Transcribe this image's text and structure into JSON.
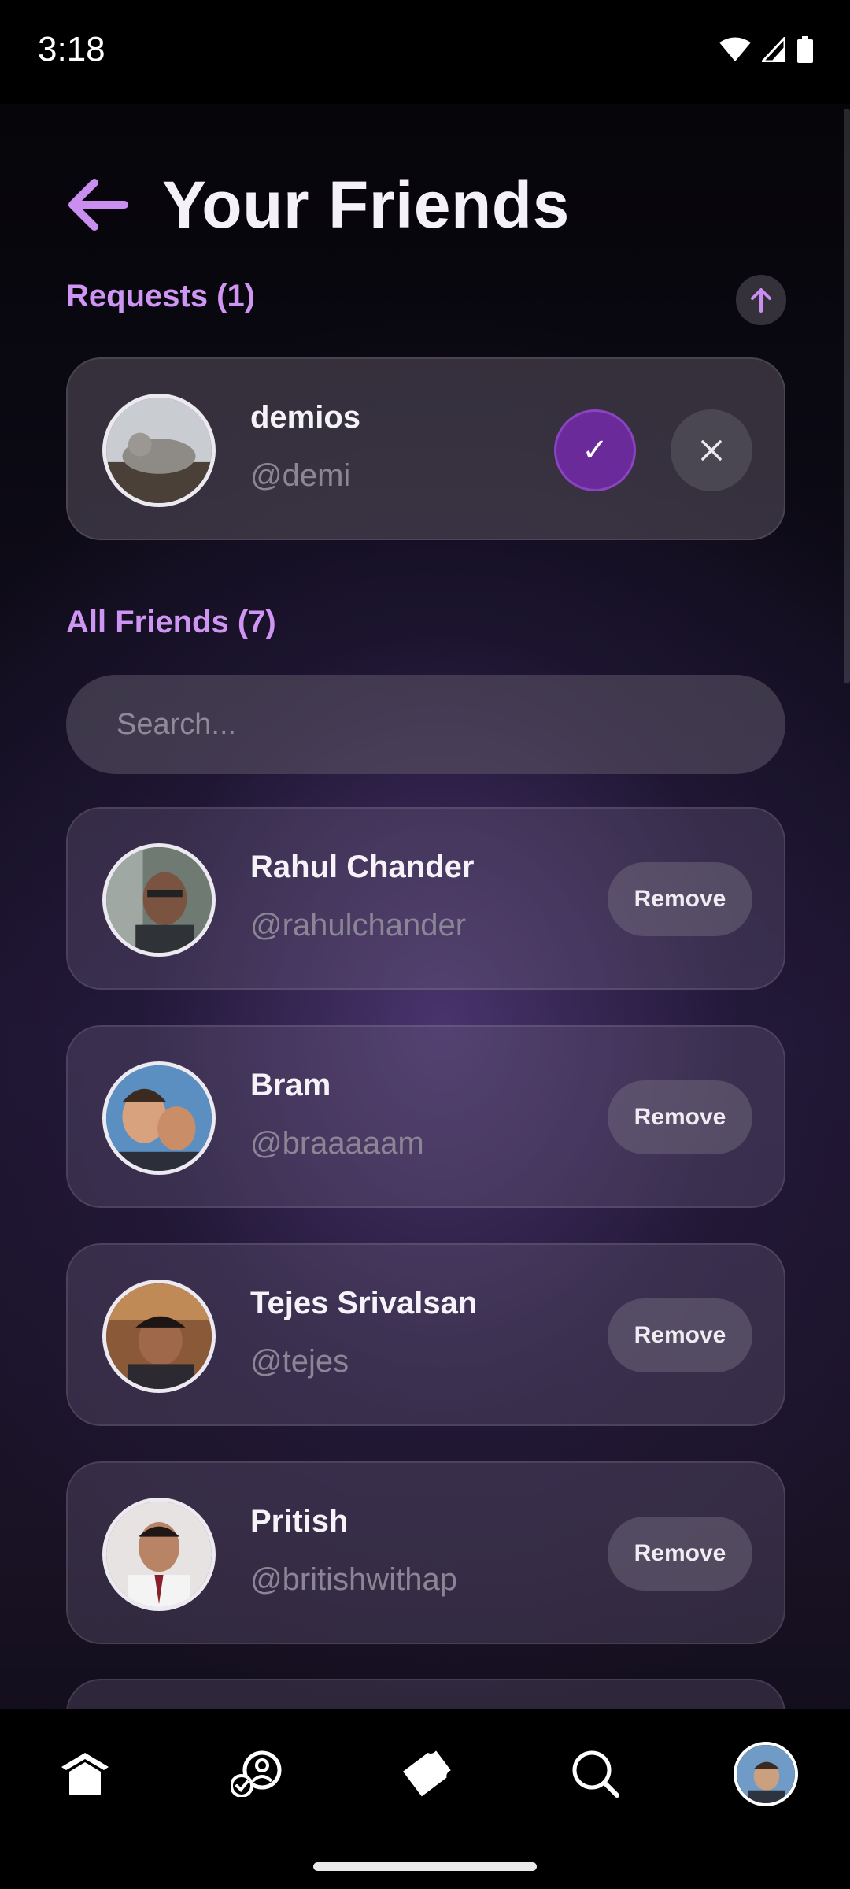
{
  "status_bar": {
    "time": "3:18"
  },
  "header": {
    "title": "Your Friends"
  },
  "requests": {
    "label": "Requests (1)",
    "items": [
      {
        "name": "demios",
        "handle": "@demi"
      }
    ]
  },
  "friends": {
    "label": "All Friends (7)",
    "search_placeholder": "Search...",
    "remove_label": "Remove",
    "items": [
      {
        "name": "Rahul Chander",
        "handle": "@rahulchander"
      },
      {
        "name": "Bram",
        "handle": "@braaaaam"
      },
      {
        "name": "Tejes Srivalsan",
        "handle": "@tejes"
      },
      {
        "name": "Pritish",
        "handle": "@britishwithap"
      }
    ]
  },
  "icons": {
    "back": "arrow-left-icon",
    "collapse": "arrow-up-icon",
    "accept": "check-icon",
    "decline": "close-icon",
    "nav": [
      "home-icon",
      "friends-icon",
      "ticket-icon",
      "search-icon",
      "profile-avatar"
    ]
  },
  "colors": {
    "accent": "#cf95f2",
    "accept": "#6a2a99"
  }
}
